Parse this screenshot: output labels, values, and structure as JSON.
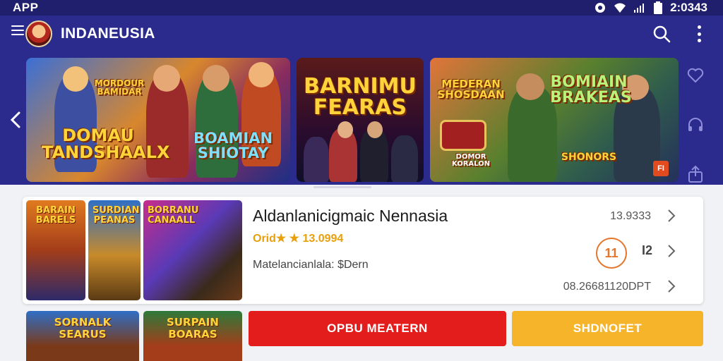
{
  "status_bar": {
    "left_text": "APP",
    "time": "2:0343"
  },
  "app_bar": {
    "title": "INDANEUSIA"
  },
  "banners": [
    {
      "title_top": "MORDOUR BAMIDAR",
      "title_main": "DOMAU TANDSHAALX",
      "title_sub": "BOAMIAN SHIOTAY"
    },
    {
      "title_main": "BARNIMU FEARAS"
    },
    {
      "title_top": "MEDERAN SHOSDAAN",
      "title_main": "BOMIAIN BRAKEAS",
      "badge_text": "DOMOR KORALON",
      "title_sub": "SHONORS",
      "corner": "FI"
    }
  ],
  "thumbs": [
    "BARAIN BARELS",
    "SURDIAN PEANAS",
    "BORRANU CANAALL"
  ],
  "bottom_thumbs": [
    "SORNALK SEARUS",
    "SURPAIN BOARAS"
  ],
  "game": {
    "name": "Aldanlanicigmaic Nennasia",
    "rating": "Orid★ ★ 13.0994",
    "subtitle": "Matelancianlala: $Dern"
  },
  "meta": {
    "value_1": "13.9333",
    "value_2": "I2",
    "value_3": "08.26681120DPT",
    "counter": "11"
  },
  "buttons": {
    "open": "OPBU MEATERN",
    "share": "SHDNOFET"
  },
  "colors": {
    "primary": "#2b2b8e",
    "open": "#e31c1c",
    "share": "#f6b42a",
    "rating": "#e8a00c"
  }
}
